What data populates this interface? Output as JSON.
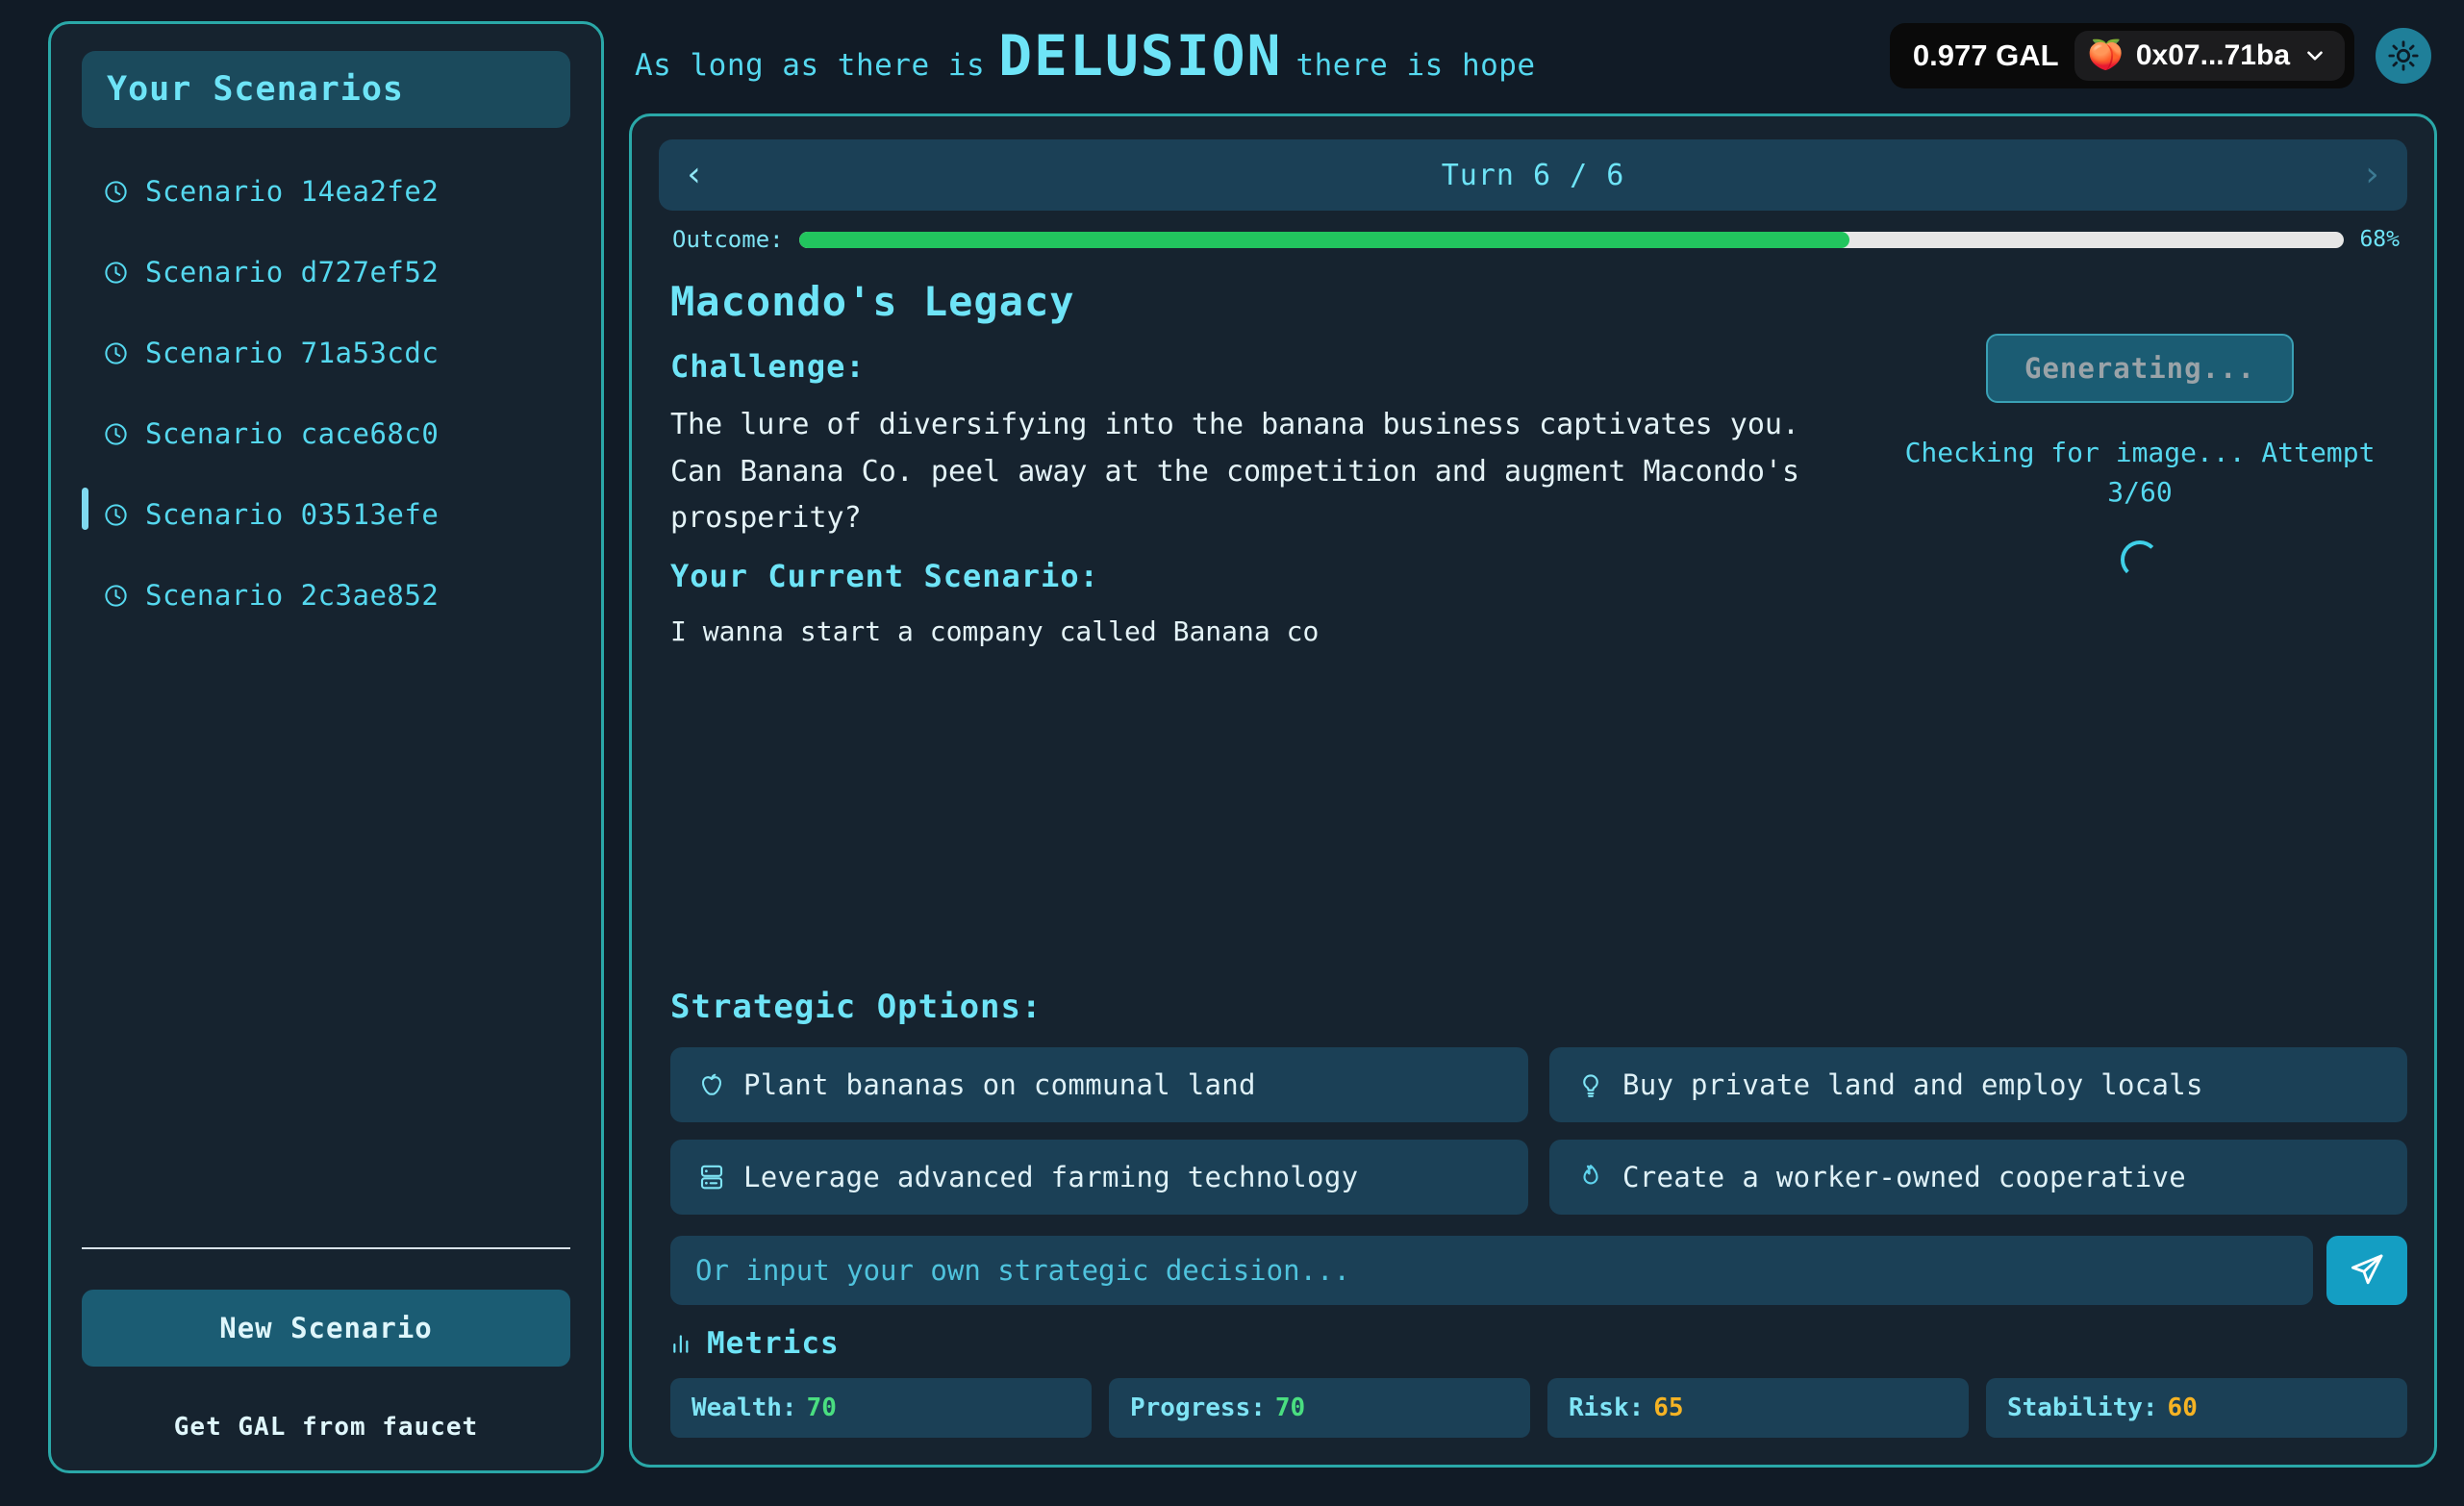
{
  "sidebar": {
    "header_title": "Your Scenarios",
    "scenarios": [
      {
        "label": "Scenario 14ea2fe2",
        "icon": "clock-icon",
        "active": false
      },
      {
        "label": "Scenario d727ef52",
        "icon": "clock-icon",
        "active": false
      },
      {
        "label": "Scenario 71a53cdc",
        "icon": "clock-icon",
        "active": false
      },
      {
        "label": "Scenario cace68c0",
        "icon": "clock-icon",
        "active": false
      },
      {
        "label": "Scenario 03513efe",
        "icon": "clock-icon",
        "active": true
      },
      {
        "label": "Scenario 2c3ae852",
        "icon": "clock-icon",
        "active": false
      }
    ],
    "new_scenario_label": "New Scenario",
    "faucet_label": "Get GAL from faucet"
  },
  "topbar": {
    "tagline_prefix": "As long as there is",
    "tagline_strong": "DELUSION",
    "tagline_suffix": "there is hope",
    "wallet": {
      "balance": "0.977 GAL",
      "emoji": "🍑",
      "address": "0x07...71ba",
      "chevron": "chevron-down-icon"
    },
    "theme_toggle_icon": "sun-icon"
  },
  "turn": {
    "prev_arrow": "‹",
    "next_arrow": "›",
    "label": "Turn 6 / 6",
    "current": 6,
    "total": 6
  },
  "outcome": {
    "label": "Outcome:",
    "percent_text": "68%",
    "percent": 68,
    "bar_color": "#22c55e",
    "track_color": "#e6e6e6"
  },
  "narrative": {
    "title": "Macondo's Legacy",
    "challenge_heading": "Challenge:",
    "challenge_text": "The lure of diversifying into the banana business captivates you. Can Banana Co. peel away at the competition and augment Macondo's prosperity?",
    "current_scenario_heading": "Your Current Scenario:",
    "current_scenario_text": "I wanna start a company called Banana co"
  },
  "image_panel": {
    "generate_button_label": "Generating...",
    "status_text": "Checking for image... Attempt 3/60",
    "spinner_icon": "loading-spinner-icon"
  },
  "options": {
    "heading": "Strategic Options:",
    "items": [
      {
        "label": "Plant bananas on communal land",
        "icon": "apple-icon"
      },
      {
        "label": "Buy private land and employ locals",
        "icon": "lightbulb-icon"
      },
      {
        "label": "Leverage advanced farming technology",
        "icon": "server-icon"
      },
      {
        "label": "Create a worker-owned cooperative",
        "icon": "flame-icon"
      }
    ]
  },
  "decision_input": {
    "placeholder": "Or input your own strategic decision...",
    "value": "",
    "send_icon": "send-icon"
  },
  "metrics": {
    "heading": "Metrics",
    "heading_icon": "bar-chart-icon",
    "items": [
      {
        "name": "Wealth:",
        "value": "70",
        "color": "#4ade80"
      },
      {
        "name": "Progress:",
        "value": "70",
        "color": "#4ade80"
      },
      {
        "name": "Risk:",
        "value": "65",
        "color": "#f5b324"
      },
      {
        "name": "Stability:",
        "value": "60",
        "color": "#f5b324"
      }
    ]
  }
}
